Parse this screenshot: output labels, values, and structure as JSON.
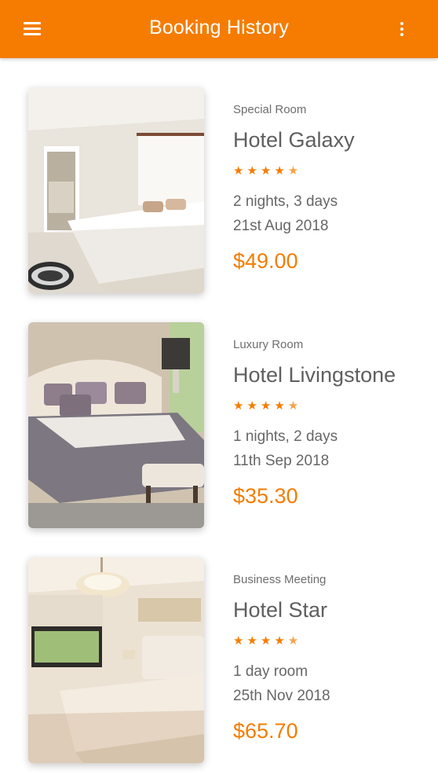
{
  "app_bar": {
    "title": "Booking History",
    "menu_icon": "hamburger-menu-icon",
    "overflow_icon": "more-vertical-icon",
    "color": "#f57c00"
  },
  "bookings": [
    {
      "category": "Special Room",
      "hotel_name": "Hotel Galaxy",
      "rating": 4.5,
      "stars": "★★★★",
      "half_star": "★",
      "duration": "2 nights, 3 days",
      "date": "21st Aug 2018",
      "price": "$49.00",
      "image": "hotel-room-photo"
    },
    {
      "category": "Luxury Room",
      "hotel_name": "Hotel Livingstone",
      "rating": 4.5,
      "stars": "★★★★",
      "half_star": "★",
      "duration": "1 nights, 2 days",
      "date": "11th Sep 2018",
      "price": "$35.30",
      "image": "hotel-room-photo"
    },
    {
      "category": "Business Meeting",
      "hotel_name": "Hotel Star",
      "rating": 4.5,
      "stars": "★★★★",
      "half_star": "★",
      "duration": "1 day room",
      "date": "25th Nov 2018",
      "price": "$65.70",
      "image": "hotel-room-photo"
    }
  ]
}
